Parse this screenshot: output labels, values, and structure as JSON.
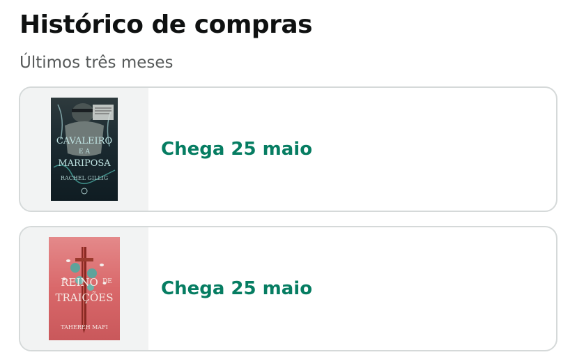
{
  "header": {
    "title": "Histórico de compras",
    "subtitle": "Últimos três meses"
  },
  "orders": [
    {
      "cover": {
        "title_line1": "CAVALEIRO",
        "title_line2": "E A",
        "title_line3": "MARIPOSA",
        "author": "RACHEL GILLIG"
      },
      "delivery_status": "Chega 25 maio"
    },
    {
      "cover": {
        "title_line1": "REINO",
        "title_line1b": "DE",
        "title_line2": "TRAIÇÕES",
        "author": "TAHEREH MAFI"
      },
      "delivery_status": "Chega 25 maio"
    }
  ],
  "colors": {
    "delivery_text": "#067d62",
    "card_border": "#d5d9d9",
    "thumb_bg": "#f2f3f3"
  }
}
